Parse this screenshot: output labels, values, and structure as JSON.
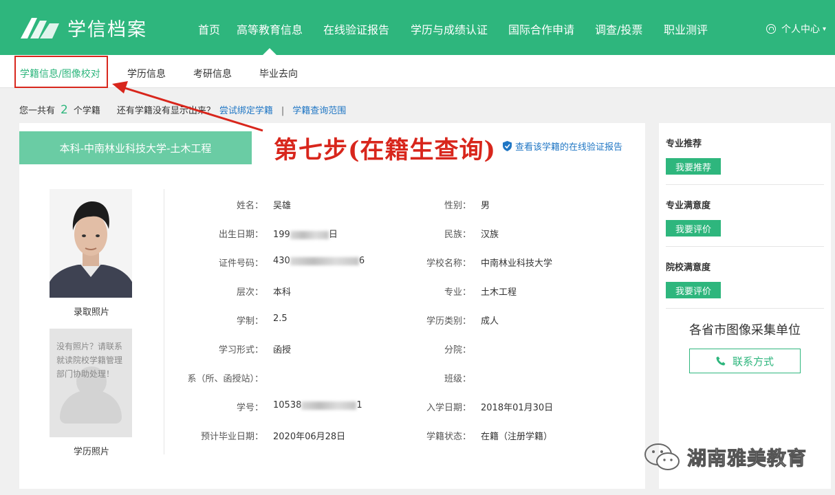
{
  "brand": {
    "name": "学信档案"
  },
  "nav": {
    "items": [
      "首页",
      "高等教育信息",
      "在线验证报告",
      "学历与成绩认证",
      "国际合作申请",
      "调查/投票",
      "职业测评"
    ],
    "user_center": "个人中心"
  },
  "subnav": {
    "items": [
      "学籍信息/图像校对",
      "学历信息",
      "考研信息",
      "毕业去向"
    ]
  },
  "infobar": {
    "prefix": "您一共有",
    "count": "2",
    "suffix": "个学籍",
    "question": "还有学籍没有显示出来？",
    "bind_link": "尝试绑定学籍",
    "separator": "|",
    "scope_link": "学籍查询范围"
  },
  "record": {
    "major_tab": "本科-中南林业科技大学-土木工程",
    "verify_link": "查看该学籍的在线验证报告",
    "annotation": "第七步(在籍生查询)",
    "photo_caption": "录取照片",
    "placeholder_text": "没有照片？请联系就读院校学籍管理部门协助处理！",
    "diploma_photo_caption": "学历照片",
    "fields_left": [
      {
        "label": "姓名：",
        "value": "吴雄"
      },
      {
        "label": "出生日期：",
        "value": "199",
        "value_tail": "日"
      },
      {
        "label": "证件号码：",
        "value": "430",
        "value_tail": "6"
      },
      {
        "label": "层次：",
        "value": "本科"
      },
      {
        "label": "学制：",
        "value": "2.5"
      },
      {
        "label": "学习形式：",
        "value": "函授"
      },
      {
        "label": "系（所、函授站）：",
        "value": ""
      },
      {
        "label": "学号：",
        "value": "10538",
        "value_tail": "1"
      },
      {
        "label": "预计毕业日期：",
        "value": "2020年06月28日"
      }
    ],
    "fields_right": [
      {
        "label": "性别：",
        "value": "男"
      },
      {
        "label": "民族：",
        "value": "汉族"
      },
      {
        "label": "学校名称：",
        "value": "中南林业科技大学"
      },
      {
        "label": "专业：",
        "value": "土木工程"
      },
      {
        "label": "学历类别：",
        "value": "成人"
      },
      {
        "label": "分院：",
        "value": ""
      },
      {
        "label": "班级：",
        "value": ""
      },
      {
        "label": "入学日期：",
        "value": "2018年01月30日"
      },
      {
        "label": "学籍状态：",
        "value": "在籍（注册学籍）"
      }
    ]
  },
  "right_panel": {
    "sections": [
      {
        "title": "专业推荐",
        "button": "我要推荐"
      },
      {
        "title": "专业满意度",
        "button": "我要评价"
      },
      {
        "title": "院校满意度",
        "button": "我要评价"
      }
    ],
    "collect_title": "各省市图像采集单位",
    "contact_button": "联系方式"
  },
  "watermark": {
    "text": "湖南雅美教育"
  },
  "colors": {
    "brand_green": "#2eb67d",
    "link_blue": "#1f76c4",
    "annotation_red": "#d8261c",
    "tab_green": "#6acca4"
  }
}
